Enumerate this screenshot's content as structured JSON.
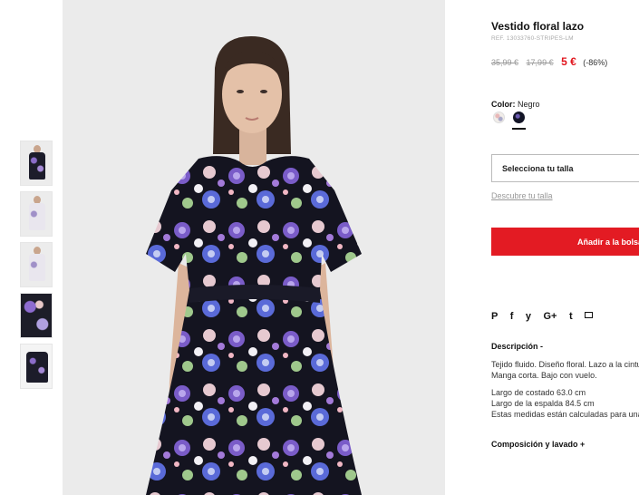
{
  "product": {
    "title": "Vestido floral lazo",
    "ref": "REF. 13033760-STRIPES-LM",
    "price_original": "35,99 €",
    "price_previous": "17,99 €",
    "price_sale": "5 €",
    "discount": "(-86%)"
  },
  "color": {
    "label": "Color:",
    "value": "Negro",
    "options": [
      "cream-floral-swatch",
      "black-floral-swatch"
    ],
    "selected_index": 1
  },
  "size": {
    "select_label": "Selecciona tu talla",
    "guide_link": "Descubre tu talla"
  },
  "cart": {
    "add_label": "Añadir a la bolsa"
  },
  "share": {
    "icons": [
      "pinterest-icon",
      "facebook-icon",
      "twitter-icon",
      "google-plus-icon",
      "tumblr-icon",
      "email-icon"
    ],
    "labels": [
      "P",
      "f",
      "y",
      "G+",
      "t"
    ]
  },
  "description": {
    "heading": "Descripción -",
    "line1": "Tejido fluido. Diseño floral. Lazo a la cintura.",
    "line2": "Manga corta. Bajo con vuelo.",
    "line3": "Largo de costado 63.0 cm",
    "line4": "Largo de la espalda 84.5 cm",
    "line5": "Estas medidas están calculadas para una talla S."
  },
  "composition": {
    "heading": "Composición y lavado +"
  },
  "colors": {
    "accent_red": "#e31b23",
    "sale_red": "#e1141c"
  }
}
